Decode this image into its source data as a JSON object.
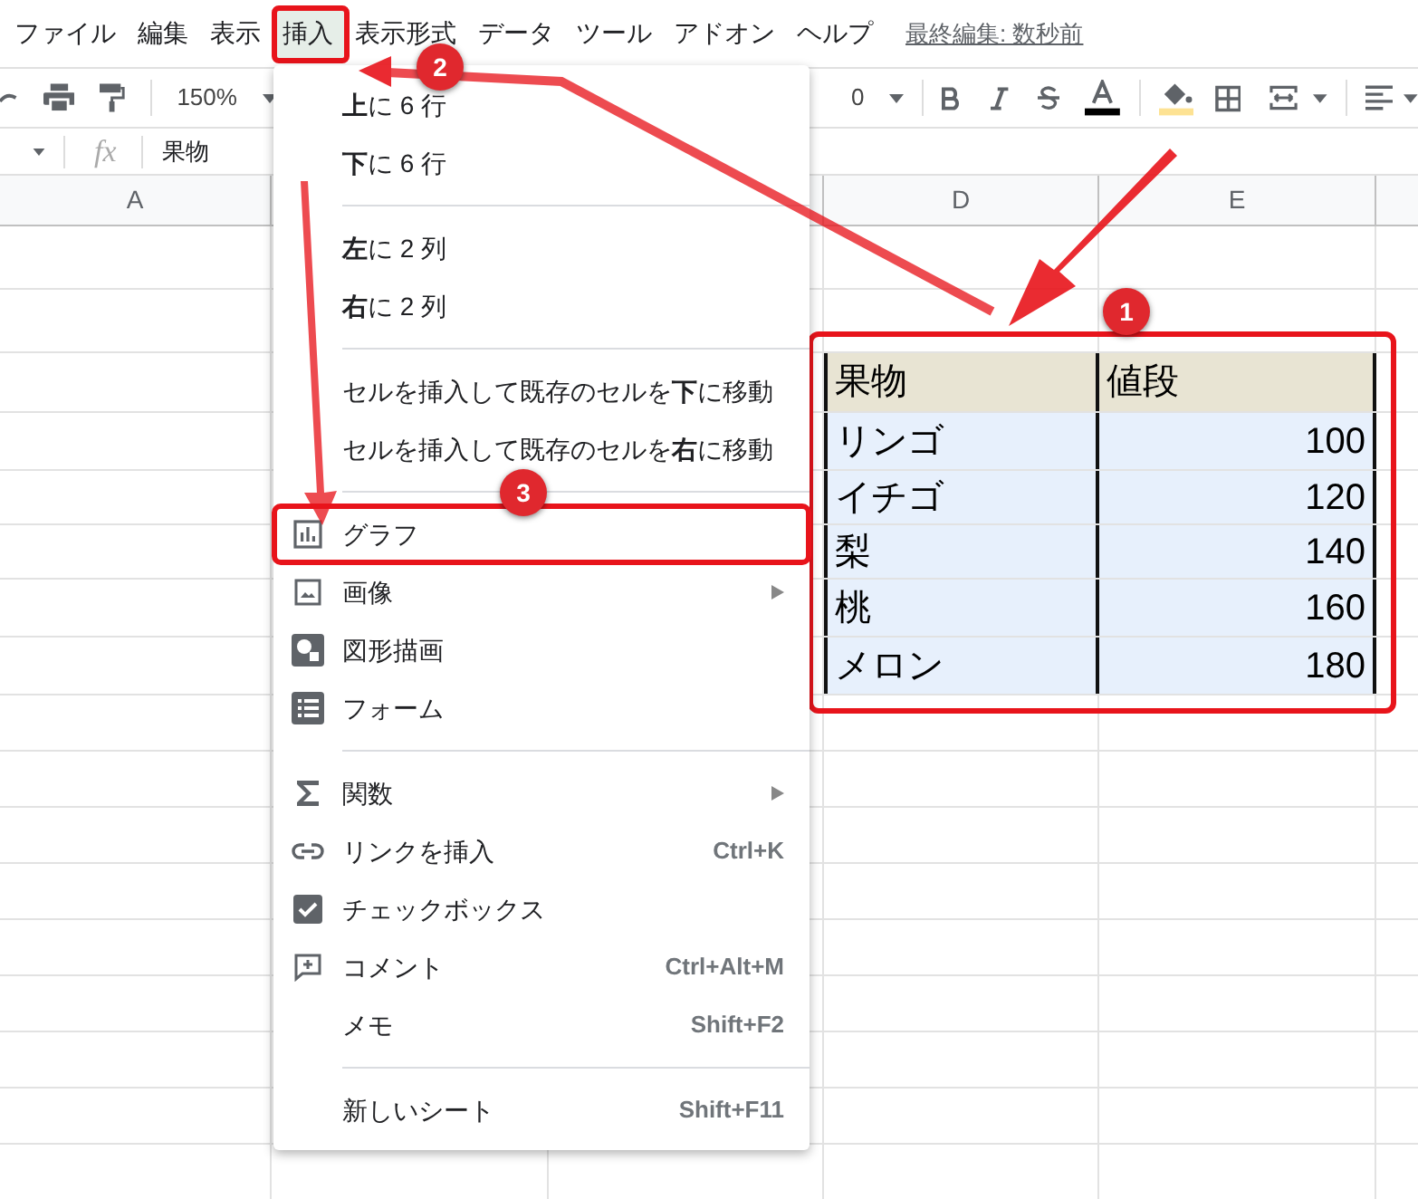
{
  "menubar": {
    "items": [
      {
        "label": "ファイル",
        "selected": false
      },
      {
        "label": "編集",
        "selected": false
      },
      {
        "label": "表示",
        "selected": false
      },
      {
        "label": "挿入",
        "selected": true
      },
      {
        "label": "表示形式",
        "selected": false
      },
      {
        "label": "データ",
        "selected": false
      },
      {
        "label": "ツール",
        "selected": false
      },
      {
        "label": "アドオン",
        "selected": false
      },
      {
        "label": "ヘルプ",
        "selected": false
      }
    ],
    "last_edit": "最終編集: 数秒前"
  },
  "toolbar": {
    "zoom": "150%",
    "font_size": "0"
  },
  "formula_bar": {
    "fx": "fx",
    "value": "果物"
  },
  "sheet": {
    "columns": [
      "A",
      "",
      "",
      "D",
      "E"
    ],
    "table": {
      "header": [
        "果物",
        "値段"
      ],
      "rows": [
        [
          "リンゴ",
          "100"
        ],
        [
          "イチゴ",
          "120"
        ],
        [
          "梨",
          "140"
        ],
        [
          "桃",
          "160"
        ],
        [
          "メロン",
          "180"
        ]
      ]
    }
  },
  "menu": {
    "sections": [
      [
        {
          "kind": "plain",
          "label": "**上**に 6 行"
        },
        {
          "kind": "plain",
          "label": "**下**に 6 行"
        }
      ],
      [
        {
          "kind": "plain",
          "label": "**左**に 2 列"
        },
        {
          "kind": "plain",
          "label": "**右**に 2 列"
        }
      ],
      [
        {
          "kind": "plain",
          "label": "セルを挿入して既存のセルを**下**に移動"
        },
        {
          "kind": "plain",
          "label": "セルを挿入して既存のセルを**右**に移動"
        }
      ],
      [
        {
          "kind": "chart",
          "label": "グラフ",
          "highlighted": true
        },
        {
          "kind": "image",
          "label": "画像",
          "submenu": true
        },
        {
          "kind": "drawing",
          "label": "図形描画"
        },
        {
          "kind": "form",
          "label": "フォーム"
        }
      ],
      [
        {
          "kind": "function",
          "label": "関数",
          "submenu": true
        },
        {
          "kind": "link",
          "label": "リンクを挿入",
          "shortcut": "Ctrl+K"
        },
        {
          "kind": "checkbox",
          "label": "チェックボックス"
        },
        {
          "kind": "comment",
          "label": "コメント",
          "shortcut": "Ctrl+Alt+M"
        },
        {
          "kind": "plain",
          "label": "メモ",
          "shortcut": "Shift+F2"
        }
      ],
      [
        {
          "kind": "plain",
          "label": "新しいシート",
          "shortcut": "Shift+F11"
        }
      ]
    ]
  },
  "annotations": [
    {
      "label": "1"
    },
    {
      "label": "2"
    },
    {
      "label": "3"
    }
  ]
}
